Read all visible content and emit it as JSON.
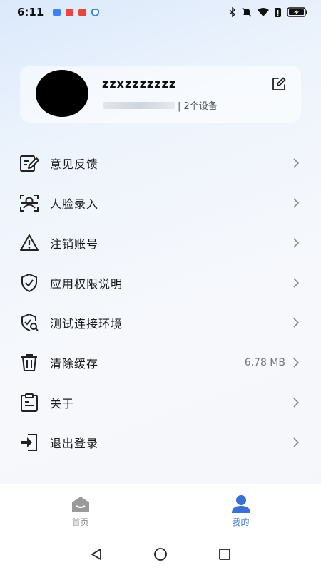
{
  "status_bar": {
    "time": "6:11",
    "app_icons": [
      {
        "name": "app-icon-blue",
        "color": "#3b82f6"
      },
      {
        "name": "app-icon-red",
        "color": "#ef4444"
      },
      {
        "name": "app-icon-redgold",
        "color": "#e5483a"
      },
      {
        "name": "app-icon-shield",
        "color": "#3b82f6"
      }
    ],
    "system_icons": [
      "bluetooth-icon",
      "mute-icon",
      "wifi-icon",
      "alert-icon",
      "battery-charging-icon"
    ]
  },
  "profile": {
    "username": "zzxzzzzzzz",
    "devices": "| 2个设备"
  },
  "menu": {
    "items": [
      {
        "label": "意见反馈",
        "icon": "feedback-icon"
      },
      {
        "label": "人脸录入",
        "icon": "face-scan-icon"
      },
      {
        "label": "注销账号",
        "icon": "warning-icon"
      },
      {
        "label": "应用权限说明",
        "icon": "shield-check-icon"
      },
      {
        "label": "测试连接环境",
        "icon": "shield-search-icon"
      },
      {
        "label": "清除缓存",
        "icon": "trash-icon",
        "value": "6.78 MB"
      },
      {
        "label": "关于",
        "icon": "clipboard-icon"
      },
      {
        "label": "退出登录",
        "icon": "logout-icon"
      }
    ]
  },
  "bottom_nav": {
    "tabs": [
      {
        "label": "首页",
        "icon": "home-icon",
        "active": false
      },
      {
        "label": "我的",
        "icon": "user-icon",
        "active": true
      }
    ],
    "active_color": "#3a6fd8",
    "inactive_color": "#8a8a8a"
  }
}
